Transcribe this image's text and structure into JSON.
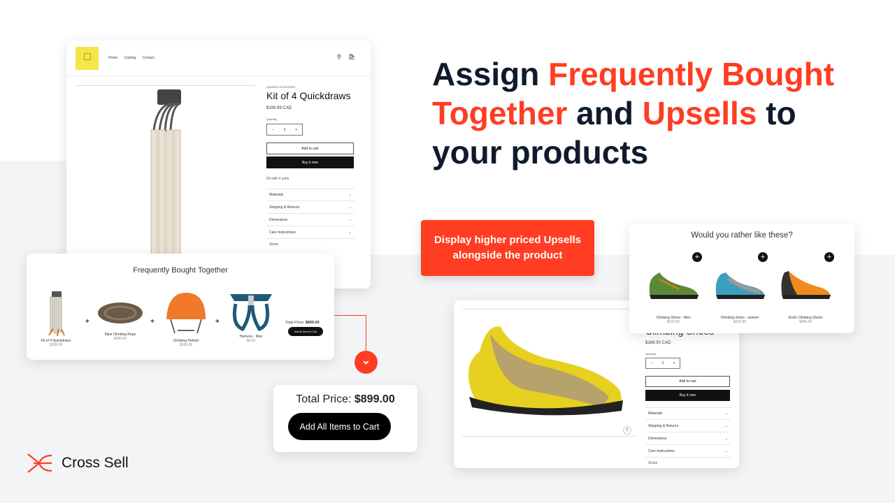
{
  "headline": {
    "w1": "Assign ",
    "w2": "Frequently Bought",
    "w3": "Together",
    "w4": " and ",
    "w5": "Upsells",
    "w6": " to",
    "w7": "your products"
  },
  "colors": {
    "accent": "#ff3d23",
    "navy": "#0f1b2d"
  },
  "store": {
    "nav": [
      "Home",
      "Catalog",
      "Contact"
    ],
    "vendor": "GEARED OUTDOORS",
    "title": "Kit of 4 Quickdraws",
    "price": "$199.99 CAD",
    "quantity_label": "Quantity",
    "quantity": "1",
    "add_to_cart": "Add to cart",
    "buy_now": "Buy it now",
    "description": "Kit with 4 units",
    "accordion": [
      "Materials",
      "Shipping & Returns",
      "Dimensions",
      "Care Instructions"
    ],
    "share": "Share",
    "cart_count": "0"
  },
  "fbt": {
    "title": "Frequently Bought Together",
    "items": [
      {
        "name": "Kit of 4 Quickdraws",
        "price": "$199.99"
      },
      {
        "name": "Maxi Climbing Rope",
        "price": "$295.00"
      },
      {
        "name": "Climbing Helmet",
        "price": "$149.95"
      },
      {
        "name": "Harness - Men",
        "price": "$0.00"
      }
    ],
    "total_label": "Total Price:",
    "total": "$899.00",
    "add_all": "Add All Items to Cart"
  },
  "total_card": {
    "label": "Total Price:",
    "value": "$899.00",
    "button": "Add All Items to Cart"
  },
  "callout": {
    "line1": "Display higher priced Upsells",
    "line2": "alongside the product"
  },
  "upsell": {
    "title": "Would you rather like these?",
    "items": [
      {
        "name": "Climbing Shoes - Men",
        "price": "$210.00"
      },
      {
        "name": "Climbing shoes - women",
        "price": "$219.99"
      },
      {
        "name": "Evolv Climbing Shoes",
        "price": "$245.00"
      }
    ]
  },
  "product2": {
    "title": "Climbing Shoes",
    "price": "$189.00 CAD",
    "quantity_label": "Quantity",
    "quantity": "1",
    "add_to_cart": "Add to cart",
    "buy_now": "Buy it now",
    "accordion": [
      "Materials",
      "Shipping & Returns",
      "Dimensions",
      "Care Instructions"
    ],
    "share": "Share"
  },
  "brand": {
    "name": "Cross Sell"
  }
}
